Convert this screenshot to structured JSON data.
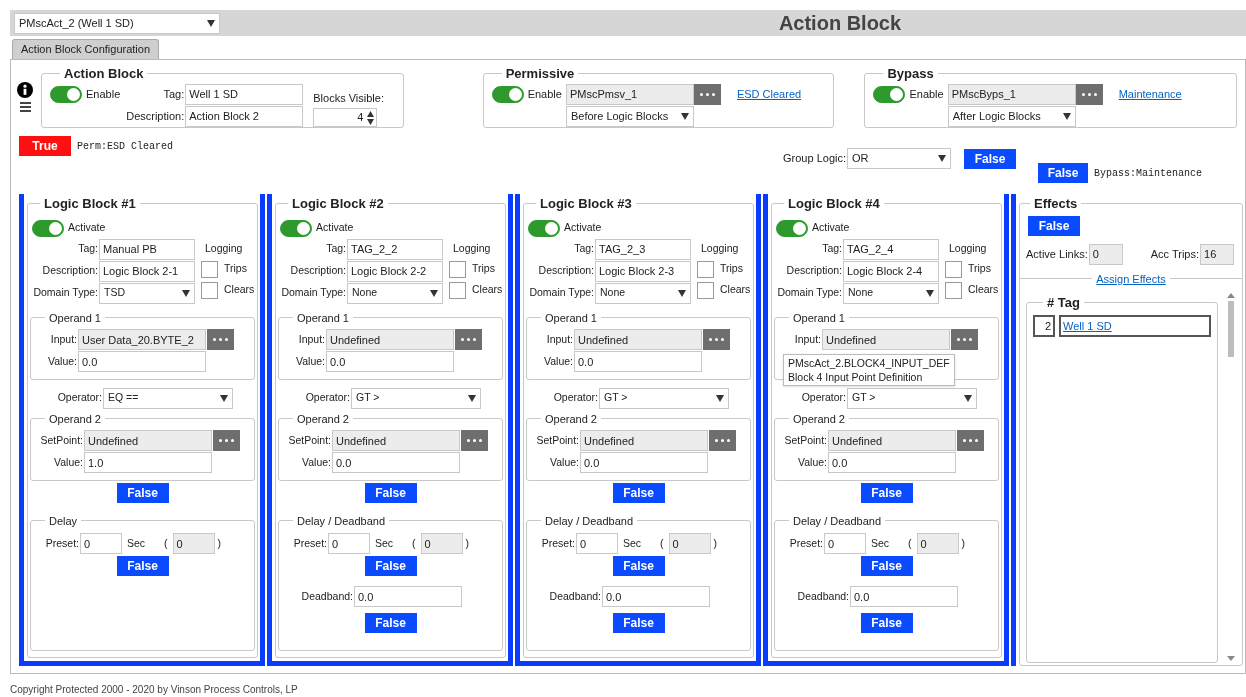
{
  "selector": {
    "value": "PMscAct_2 (Well 1 SD)"
  },
  "title": "Action Block",
  "tabs": [
    {
      "label": "Action Block Configuration",
      "selected": true
    }
  ],
  "action_block": {
    "legend": "Action Block",
    "enable": {
      "label": "Enable",
      "on": true
    },
    "tag": {
      "label": "Tag:",
      "value": "Well 1 SD"
    },
    "description": {
      "label": "Description:",
      "value": "Action Block 2"
    },
    "blocks_visible": {
      "label": "Blocks Visible:",
      "value": "4"
    }
  },
  "permissive": {
    "legend": "Permissive",
    "enable": {
      "label": "Enable",
      "on": true
    },
    "point": "PMscPmsv_1",
    "order": "Before Logic Blocks",
    "link": "ESD Cleared"
  },
  "bypass": {
    "legend": "Bypass",
    "enable": {
      "label": "Enable",
      "on": true
    },
    "point": "PMscByps_1",
    "order": "After Logic Blocks",
    "link": "Maintenance"
  },
  "result": {
    "label": "True",
    "active": true,
    "note": "Perm:ESD Cleared"
  },
  "group_logic": {
    "label": "Group Logic:",
    "value": "OR",
    "result": {
      "label": "False",
      "active": false
    }
  },
  "bypass_result": {
    "label": "False",
    "active": false,
    "note": "Bypass:Maintenance"
  },
  "logic_blocks": [
    {
      "legend": "Logic Block #1",
      "activate": {
        "label": "Activate",
        "on": true
      },
      "tag": {
        "label": "Tag:",
        "value": "Manual PB"
      },
      "description": {
        "label": "Description:",
        "value": "Logic Block 2-1"
      },
      "domain_type": {
        "label": "Domain Type:",
        "value": "TSD"
      },
      "logging": {
        "label": "Logging",
        "trips": {
          "label": "Trips",
          "checked": false
        },
        "clears": {
          "label": "Clears",
          "checked": false
        }
      },
      "operand1": {
        "legend": "Operand 1",
        "input": {
          "label": "Input:",
          "value": "User Data_20.BYTE_2"
        },
        "value": {
          "label": "Value:",
          "value": "0.0"
        }
      },
      "operator": {
        "label": "Operator:",
        "value": "EQ =="
      },
      "operand2": {
        "legend": "Operand 2",
        "setpoint": {
          "label": "SetPoint:",
          "value": "Undefined"
        },
        "value": {
          "label": "Value:",
          "value": "1.0"
        }
      },
      "compare_result": {
        "label": "False",
        "active": false
      },
      "delay": {
        "legend": "Delay",
        "preset": {
          "label": "Preset:",
          "value": "0"
        },
        "unit": "Sec",
        "open": "(",
        "elapsed": "0",
        "close": ")",
        "result": {
          "label": "False",
          "active": false
        }
      }
    },
    {
      "legend": "Logic Block #2",
      "activate": {
        "label": "Activate",
        "on": true
      },
      "tag": {
        "label": "Tag:",
        "value": "TAG_2_2"
      },
      "description": {
        "label": "Description:",
        "value": "Logic Block 2-2"
      },
      "domain_type": {
        "label": "Domain Type:",
        "value": "None"
      },
      "logging": {
        "label": "Logging",
        "trips": {
          "label": "Trips",
          "checked": false
        },
        "clears": {
          "label": "Clears",
          "checked": false
        }
      },
      "operand1": {
        "legend": "Operand 1",
        "input": {
          "label": "Input:",
          "value": "Undefined"
        },
        "value": {
          "label": "Value:",
          "value": "0.0"
        }
      },
      "operator": {
        "label": "Operator:",
        "value": "GT >"
      },
      "operand2": {
        "legend": "Operand 2",
        "setpoint": {
          "label": "SetPoint:",
          "value": "Undefined"
        },
        "value": {
          "label": "Value:",
          "value": "0.0"
        }
      },
      "compare_result": {
        "label": "False",
        "active": false
      },
      "delay": {
        "legend": "Delay / Deadband",
        "preset": {
          "label": "Preset:",
          "value": "0"
        },
        "unit": "Sec",
        "open": "(",
        "elapsed": "0",
        "close": ")",
        "result": {
          "label": "False",
          "active": false
        },
        "deadband": {
          "label": "Deadband:",
          "value": "0.0",
          "result": {
            "label": "False",
            "active": false
          }
        }
      }
    },
    {
      "legend": "Logic Block #3",
      "activate": {
        "label": "Activate",
        "on": true
      },
      "tag": {
        "label": "Tag:",
        "value": "TAG_2_3"
      },
      "description": {
        "label": "Description:",
        "value": "Logic Block 2-3"
      },
      "domain_type": {
        "label": "Domain Type:",
        "value": "None"
      },
      "logging": {
        "label": "Logging",
        "trips": {
          "label": "Trips",
          "checked": false
        },
        "clears": {
          "label": "Clears",
          "checked": false
        }
      },
      "operand1": {
        "legend": "Operand 1",
        "input": {
          "label": "Input:",
          "value": "Undefined"
        },
        "value": {
          "label": "Value:",
          "value": "0.0"
        }
      },
      "operator": {
        "label": "Operator:",
        "value": "GT >"
      },
      "operand2": {
        "legend": "Operand 2",
        "setpoint": {
          "label": "SetPoint:",
          "value": "Undefined"
        },
        "value": {
          "label": "Value:",
          "value": "0.0"
        }
      },
      "compare_result": {
        "label": "False",
        "active": false
      },
      "delay": {
        "legend": "Delay / Deadband",
        "preset": {
          "label": "Preset:",
          "value": "0"
        },
        "unit": "Sec",
        "open": "(",
        "elapsed": "0",
        "close": ")",
        "result": {
          "label": "False",
          "active": false
        },
        "deadband": {
          "label": "Deadband:",
          "value": "0.0",
          "result": {
            "label": "False",
            "active": false
          }
        }
      }
    },
    {
      "legend": "Logic Block #4",
      "activate": {
        "label": "Activate",
        "on": true
      },
      "tag": {
        "label": "Tag:",
        "value": "TAG_2_4"
      },
      "description": {
        "label": "Description:",
        "value": "Logic Block 2-4"
      },
      "domain_type": {
        "label": "Domain Type:",
        "value": "None"
      },
      "logging": {
        "label": "Logging",
        "trips": {
          "label": "Trips",
          "checked": false
        },
        "clears": {
          "label": "Clears",
          "checked": false
        }
      },
      "operand1": {
        "legend": "Operand 1",
        "input": {
          "label": "Input:",
          "value": "Undefined"
        }
      },
      "tooltip": {
        "lines": [
          "PMscAct_2.BLOCK4_INPUT_DEF",
          "Block 4 Input Point Definition"
        ]
      },
      "operator": {
        "label": "Operator:",
        "value": "GT >"
      },
      "operand2": {
        "legend": "Operand 2",
        "setpoint": {
          "label": "SetPoint:",
          "value": "Undefined"
        },
        "value": {
          "label": "Value:",
          "value": "0.0"
        }
      },
      "compare_result": {
        "label": "False",
        "active": false
      },
      "delay": {
        "legend": "Delay / Deadband",
        "preset": {
          "label": "Preset:",
          "value": "0"
        },
        "unit": "Sec",
        "open": "(",
        "elapsed": "0",
        "close": ")",
        "result": {
          "label": "False",
          "active": false
        },
        "deadband": {
          "label": "Deadband:",
          "value": "0.0",
          "result": {
            "label": "False",
            "active": false
          }
        }
      }
    }
  ],
  "effects": {
    "legend": "Effects",
    "result": {
      "label": "False",
      "active": false
    },
    "active_links": {
      "label": "Active Links:",
      "value": "0"
    },
    "acc_trips": {
      "label": "Acc Trips:",
      "value": "16"
    },
    "assign_link": "Assign Effects",
    "list": {
      "legend": "# Tag",
      "rows": [
        {
          "number": "2",
          "tag": "Well 1 SD"
        }
      ]
    }
  },
  "footer": "Copyright Protected 2000 -  2020  by Vinson Process Controls, LP"
}
